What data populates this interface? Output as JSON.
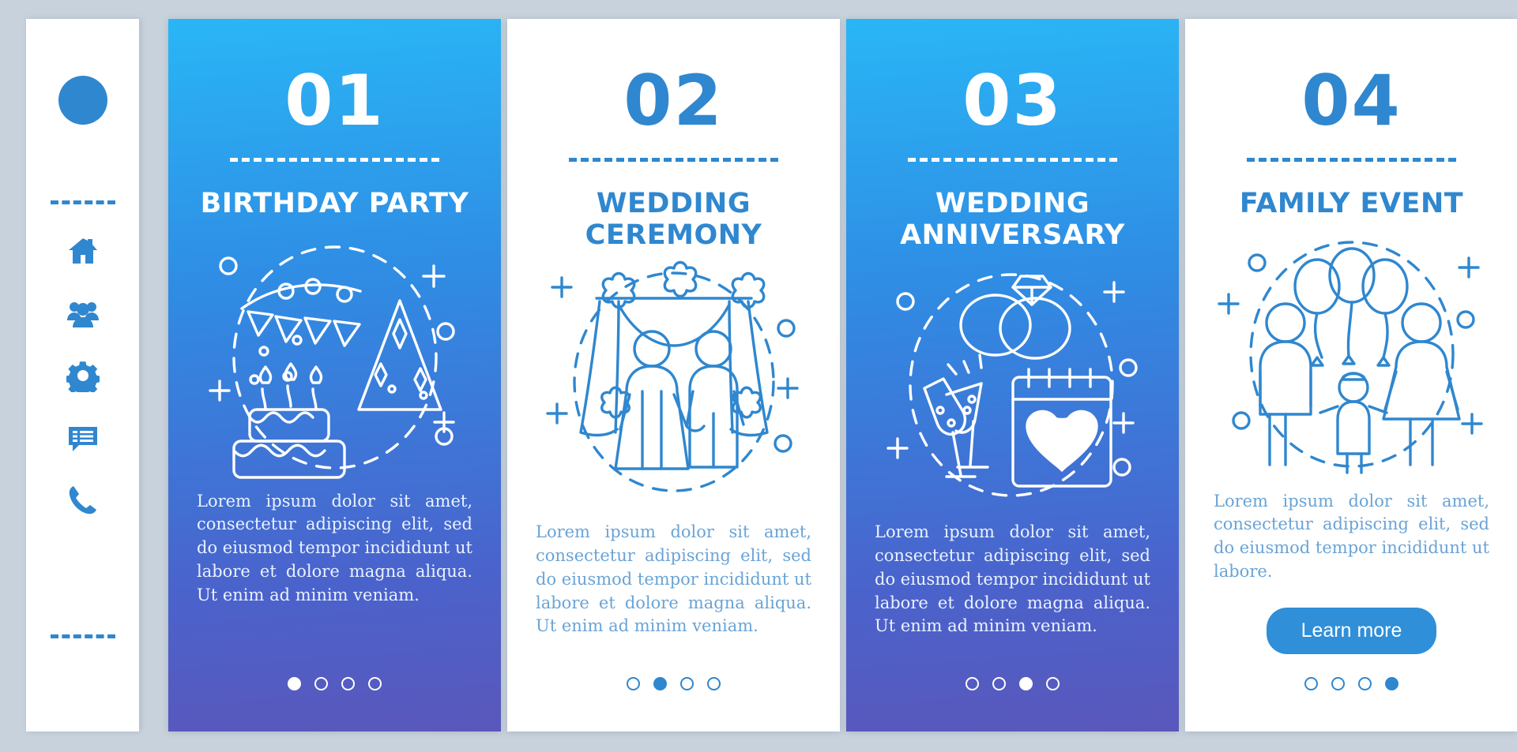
{
  "theme": {
    "page_background": "#c8d2dc",
    "accent_blue": "#2f87cf",
    "card_gradient_start": "#29b6f6",
    "card_gradient_end": "#5a57bb",
    "card_white": "#ffffff",
    "body_text_blue": "#6aa4d6",
    "button_blue": "#2f8fd8"
  },
  "sidebar": {
    "avatar": "avatar-circle",
    "top_divider": "dashed-divider",
    "bottom_divider": "dashed-divider",
    "items": [
      {
        "icon": "home-icon",
        "label": "Home"
      },
      {
        "icon": "users-icon",
        "label": "People"
      },
      {
        "icon": "gear-icon",
        "label": "Settings"
      },
      {
        "icon": "chat-icon",
        "label": "Messages"
      },
      {
        "icon": "phone-icon",
        "label": "Call"
      }
    ]
  },
  "cards": [
    {
      "number": "01",
      "title": "BIRTHDAY PARTY",
      "body": "Lorem ipsum dolor sit amet, consectetur adipiscing elit, sed do eiusmod tempor incididunt ut labore et dolore magna aliqua. Ut enim ad minim veniam.",
      "illustration": "birthday-cake-party-hat-bunting-icon",
      "style": "blue",
      "dots_total": 4,
      "dots_active": 1,
      "cta": null
    },
    {
      "number": "02",
      "title": "WEDDING CEREMONY",
      "body": "Lorem ipsum dolor sit amet, consectetur adipiscing elit, sed do eiusmod tempor incididunt ut labore et dolore magna aliqua. Ut enim ad minim veniam.",
      "illustration": "wedding-couple-arch-icon",
      "style": "white",
      "dots_total": 4,
      "dots_active": 2,
      "cta": null
    },
    {
      "number": "03",
      "title": "WEDDING ANNIVERSARY",
      "body": "Lorem ipsum dolor sit amet, consectetur adipiscing elit, sed do eiusmod tempor incididunt ut labore et dolore magna aliqua. Ut enim ad minim veniam.",
      "illustration": "wedding-rings-champagne-calendar-heart-icon",
      "style": "blue",
      "dots_total": 4,
      "dots_active": 3,
      "cta": null
    },
    {
      "number": "04",
      "title": "FAMILY EVENT",
      "body": "Lorem ipsum dolor sit amet, consectetur adipiscing elit, sed do eiusmod tempor incididunt ut labore.",
      "illustration": "family-balloons-icon",
      "style": "white",
      "dots_total": 4,
      "dots_active": 4,
      "cta": "Learn more"
    }
  ]
}
